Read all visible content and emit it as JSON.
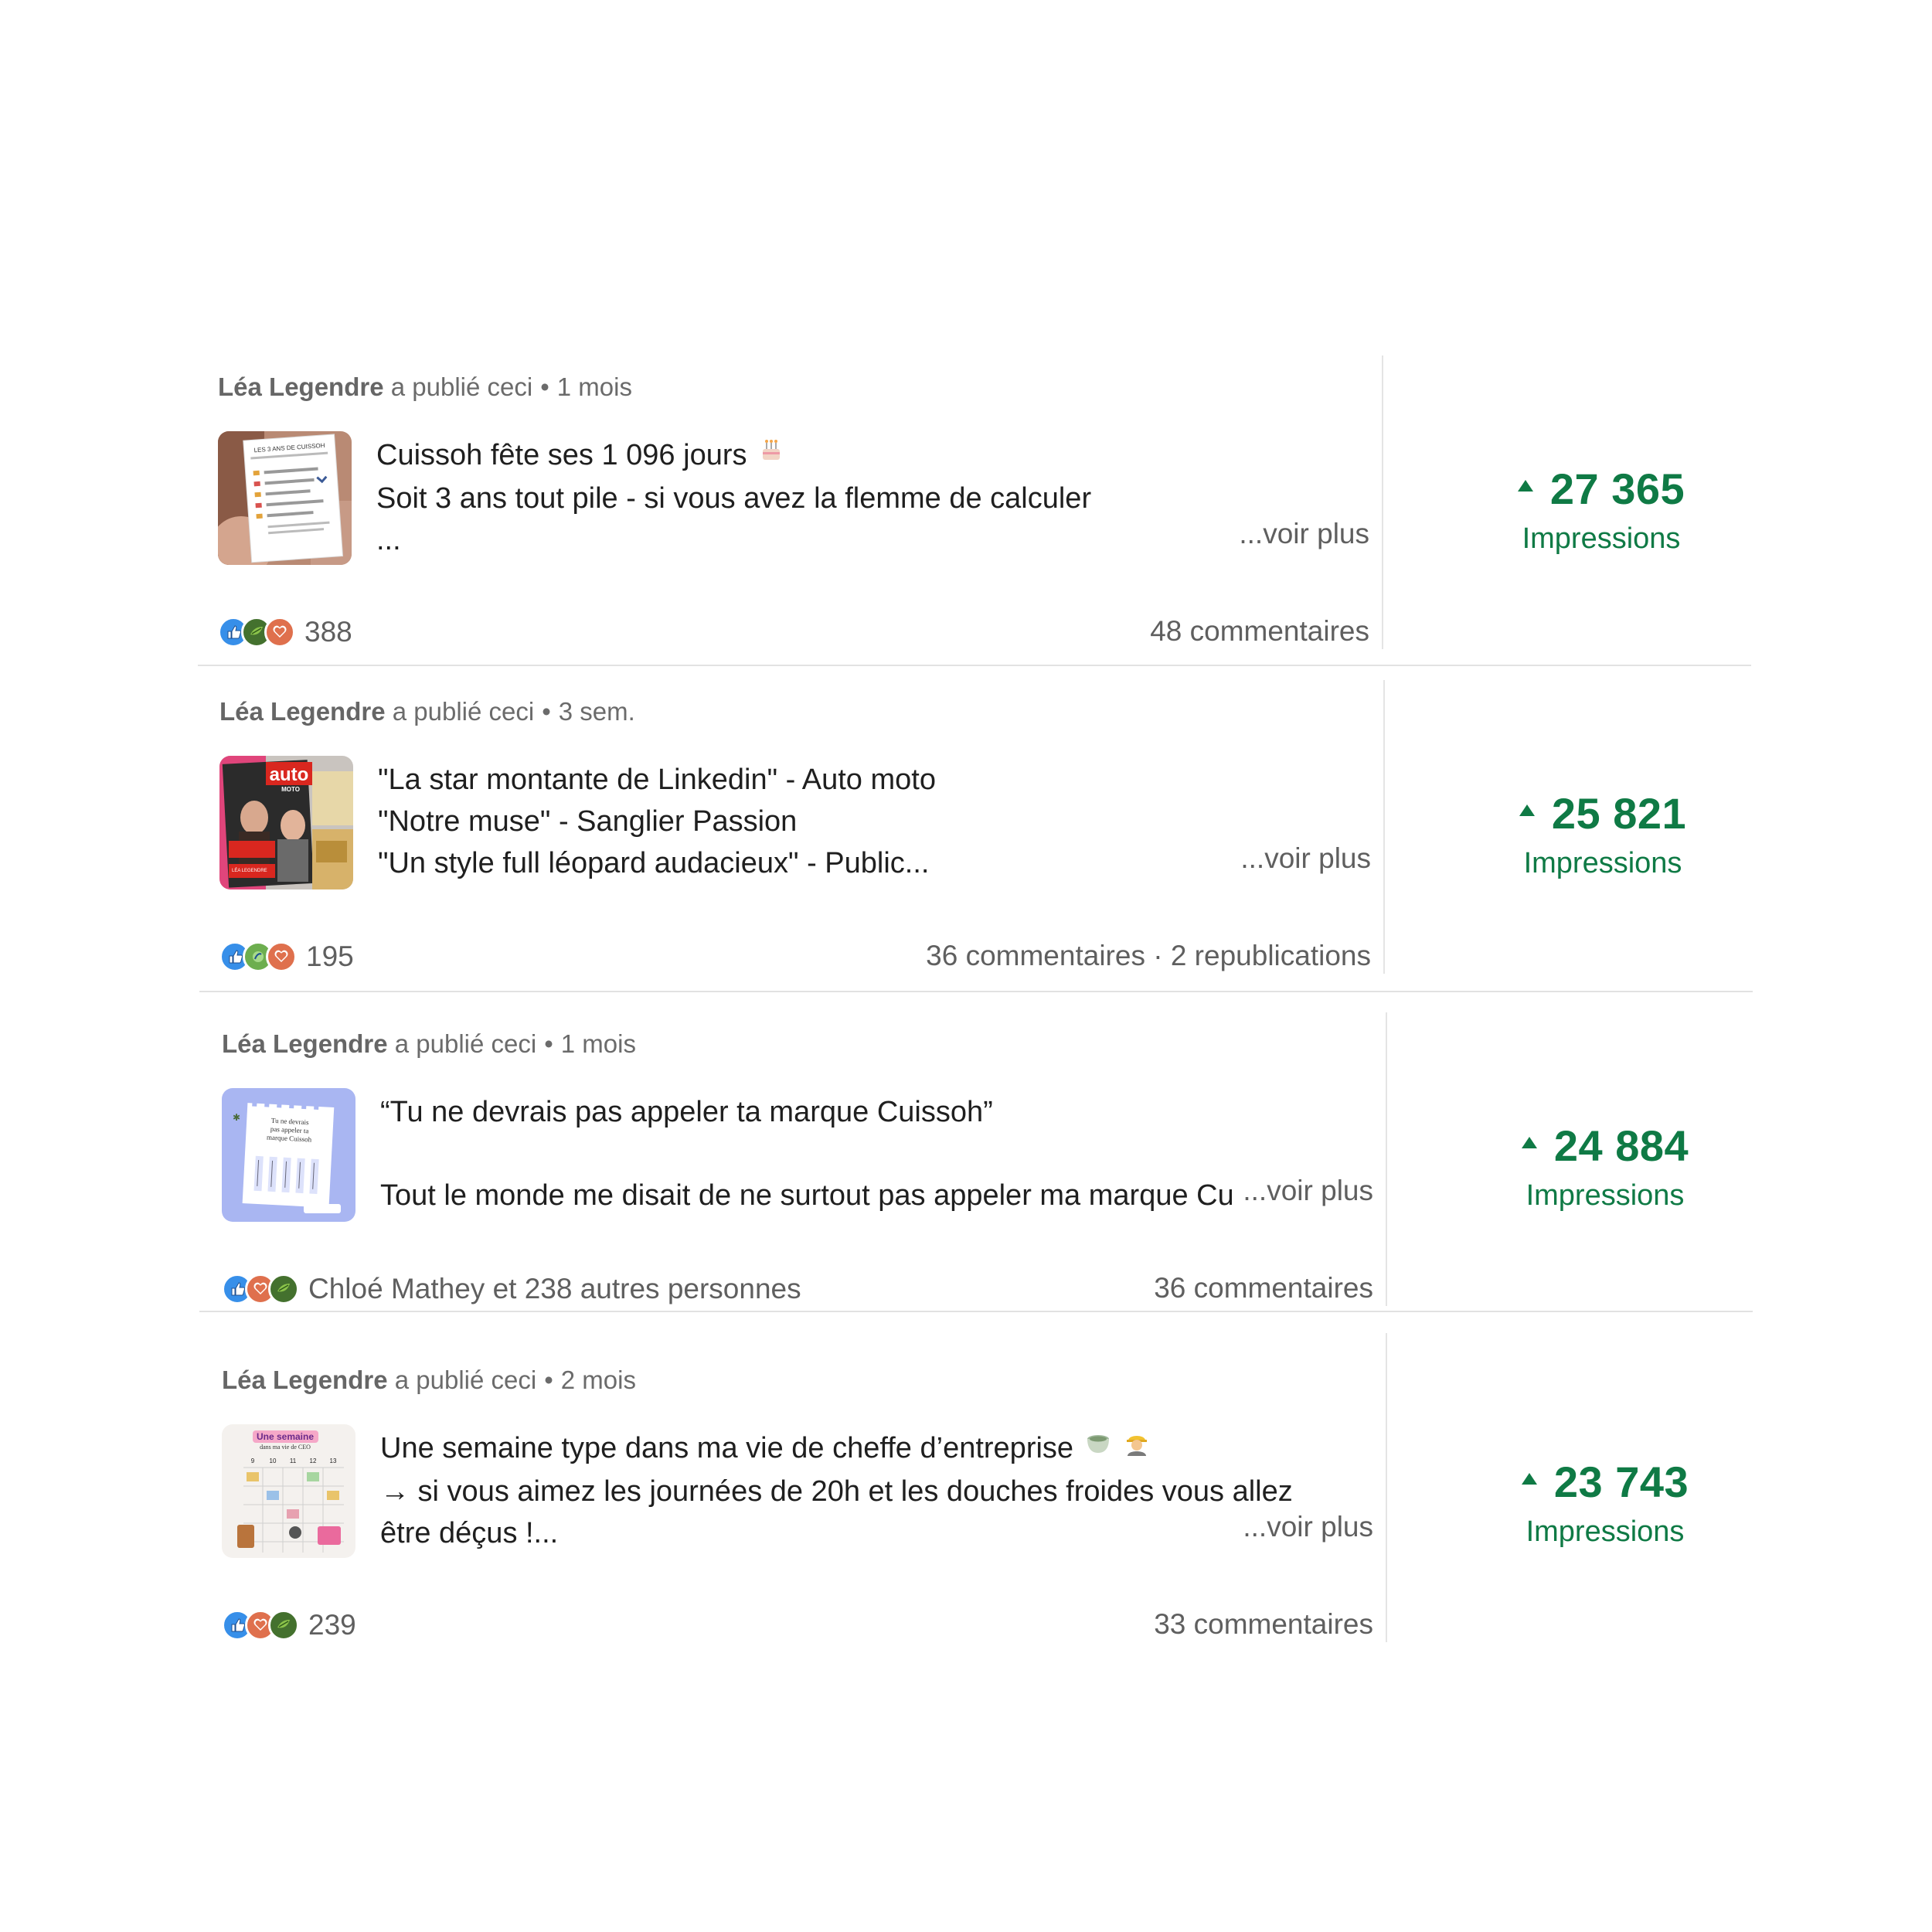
{
  "posts": [
    {
      "author": "Léa Legendre",
      "action": "a publié ceci",
      "separator": "•",
      "time": "1 mois",
      "lines": [
        "Cuissoh fête ses 1 096 jours",
        "Soit 3 ans tout pile - si vous avez la flemme de calculer",
        "..."
      ],
      "title_emoji": "cake-icon",
      "see_more": "...voir plus",
      "reactions": [
        "like-icon",
        "support-icon",
        "love-icon"
      ],
      "reaction_count": "388",
      "comments": "48 commentaires",
      "impressions": "27 365",
      "impressions_label": "Impressions"
    },
    {
      "author": "Léa Legendre",
      "action": "a publié ceci",
      "separator": "•",
      "time": "3 sem.",
      "lines": [
        "\"La star montante de Linkedin\" - Auto moto",
        "\"Notre muse\" - Sanglier Passion",
        "\"Un style full léopard audacieux\" - Public..."
      ],
      "see_more": "...voir plus",
      "reactions": [
        "like-icon",
        "celebrate-icon",
        "love-icon"
      ],
      "reaction_count": "195",
      "comments": "36 commentaires · 2 republications",
      "impressions": "25 821",
      "impressions_label": "Impressions"
    },
    {
      "author": "Léa Legendre",
      "action": "a publié ceci",
      "separator": "•",
      "time": "1 mois",
      "lines": [
        "“Tu ne devrais pas appeler ta marque Cuissoh”",
        "",
        "Tout le monde me disait de ne surtout pas appeler ma marque Cuissoh"
      ],
      "see_more": "...voir plus",
      "reactions": [
        "like-icon",
        "love-icon",
        "support-icon"
      ],
      "reaction_count": "Chloé Mathey et 238 autres personnes",
      "comments": "36 commentaires",
      "impressions": "24 884",
      "impressions_label": "Impressions"
    },
    {
      "author": "Léa Legendre",
      "action": "a publié ceci",
      "separator": "•",
      "time": "2 mois",
      "lines": [
        "Une semaine type dans ma vie de cheffe d’entreprise",
        "→ si vous aimez les journées de 20h et les douches froides vous allez",
        "être déçus !..."
      ],
      "title_emojis": [
        "tea-icon",
        "construction-worker-icon"
      ],
      "see_more": "...voir plus",
      "reactions": [
        "like-icon",
        "love-icon",
        "support-icon"
      ],
      "reaction_count": "239",
      "comments": "33 commentaires",
      "impressions": "23 743",
      "impressions_label": "Impressions"
    }
  ],
  "thumbnails": {
    "post1": {
      "title": "LES 3 ANS DE CUISSOH"
    },
    "post2": {
      "brand": "auto",
      "sub": "MOTO",
      "name": "LÉA LEGENDRE",
      "headline": "La star montante de Linkedin"
    },
    "post3": {
      "title": "Tu ne devrais pas appeler ta marque Cuissoh"
    },
    "post4": {
      "title": "Une semaine",
      "subtitle": "dans ma vie de CEO",
      "days": [
        "9",
        "10",
        "11",
        "12",
        "13"
      ]
    }
  },
  "colors": {
    "accent_green": "#0f7a45",
    "like_blue": "#378fe9",
    "love_red": "#df704d",
    "support_green": "#44712e",
    "celebrate_teal": "#6dae4f"
  }
}
